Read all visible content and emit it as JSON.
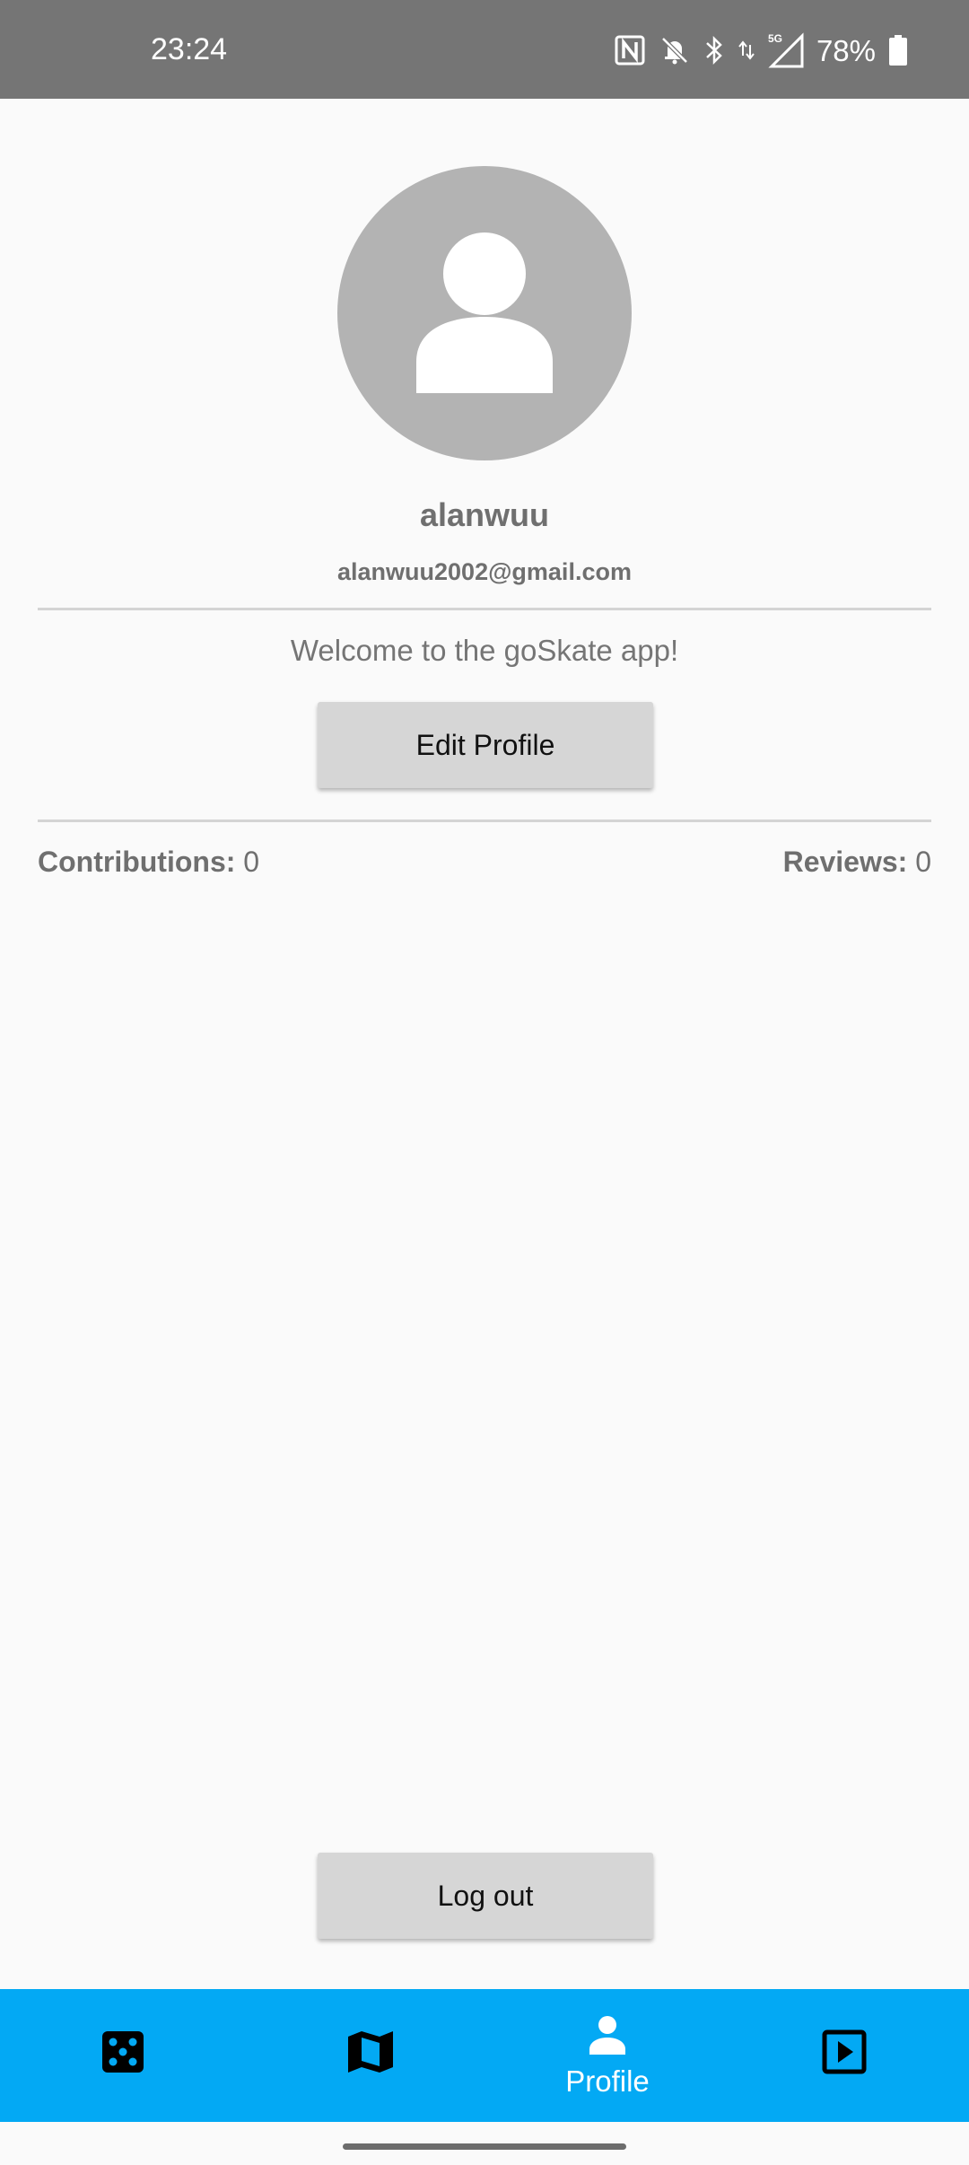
{
  "status_bar": {
    "time": "23:24",
    "battery": "78%",
    "network": "5G",
    "icons": [
      "nfc-icon",
      "bell-off-icon",
      "bluetooth-icon",
      "data-arrows-icon",
      "signal-icon",
      "battery-icon"
    ]
  },
  "profile": {
    "avatar_icon": "person-icon",
    "username": "alanwuu",
    "email": "alanwuu2002@gmail.com",
    "welcome": "Welcome to the goSkate app!",
    "edit_button": "Edit Profile"
  },
  "stats": {
    "contributions_label": "Contributions:",
    "contributions_value": " 0",
    "reviews_label": "Reviews:",
    "reviews_value": " 0"
  },
  "logout_button": "Log out",
  "bottom_nav": {
    "items": [
      {
        "icon": "dice-icon",
        "label": ""
      },
      {
        "icon": "map-icon",
        "label": ""
      },
      {
        "icon": "person-icon",
        "label": "Profile",
        "active": true
      },
      {
        "icon": "play-box-icon",
        "label": ""
      }
    ]
  },
  "colors": {
    "status_bar": "#757575",
    "accent": "#03a9f4",
    "avatar_bg": "#b3b3b3",
    "button_bg": "#d6d6d6"
  }
}
